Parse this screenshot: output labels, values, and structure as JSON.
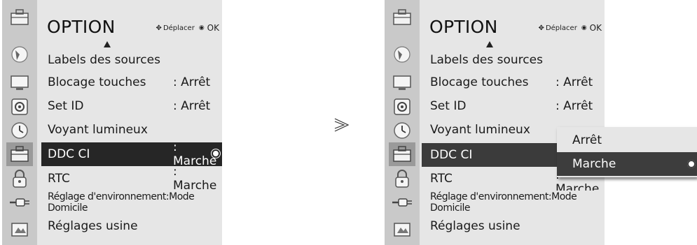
{
  "header": {
    "title": "OPTION",
    "nav_move": "Déplacer",
    "nav_ok": "OK"
  },
  "menu": {
    "items": [
      {
        "label": "Labels des sources",
        "value": ""
      },
      {
        "label": "Blocage touches",
        "value": ": Arrêt"
      },
      {
        "label": "Set ID",
        "value": ": Arrêt"
      },
      {
        "label": "Voyant lumineux",
        "value": ""
      },
      {
        "label": "DDC CI",
        "value": ": Marche"
      },
      {
        "label": "RTC",
        "value": ": Marche"
      },
      {
        "label": "Réglage d'environnement:Mode Domicile",
        "value": ""
      },
      {
        "label": "Réglages usine",
        "value": ""
      }
    ],
    "selected_index": 4
  },
  "left_screen": {
    "ddc_value": ": Marche"
  },
  "right_screen": {
    "ddc_value_partial": ": Marche"
  },
  "dropdown": {
    "options": [
      "Arrêt",
      "Marche"
    ],
    "selected": "Marche"
  },
  "icons": [
    "option-icon",
    "picture-icon",
    "screen-icon",
    "audio-icon",
    "time-icon",
    "option-icon",
    "lock-icon",
    "input-icon",
    "usb-icon"
  ],
  "colors": {
    "panel_bg": "#e6e6e6",
    "icon_column_bg": "#c9c9c9",
    "highlight_bg": "#262626",
    "dropdown_selected_bg": "#3d3d3d"
  }
}
